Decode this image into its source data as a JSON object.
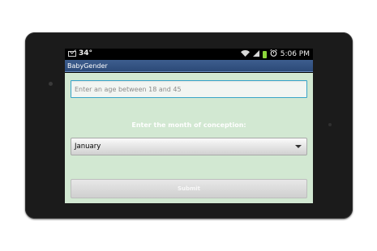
{
  "status_bar": {
    "temperature": "34°",
    "time": "5:06 PM"
  },
  "app": {
    "title": "BabyGender"
  },
  "form": {
    "age_placeholder": "Enter an age between 18 and 45",
    "age_value": "",
    "month_label": "Enter the month of conception:",
    "month_selected": "January",
    "submit_label": "Submit"
  },
  "colors": {
    "content_bg": "#d2e8d2",
    "title_bar": "#2c4a78",
    "input_focus_border": "#3aa5c9",
    "battery": "#8cd63b"
  }
}
